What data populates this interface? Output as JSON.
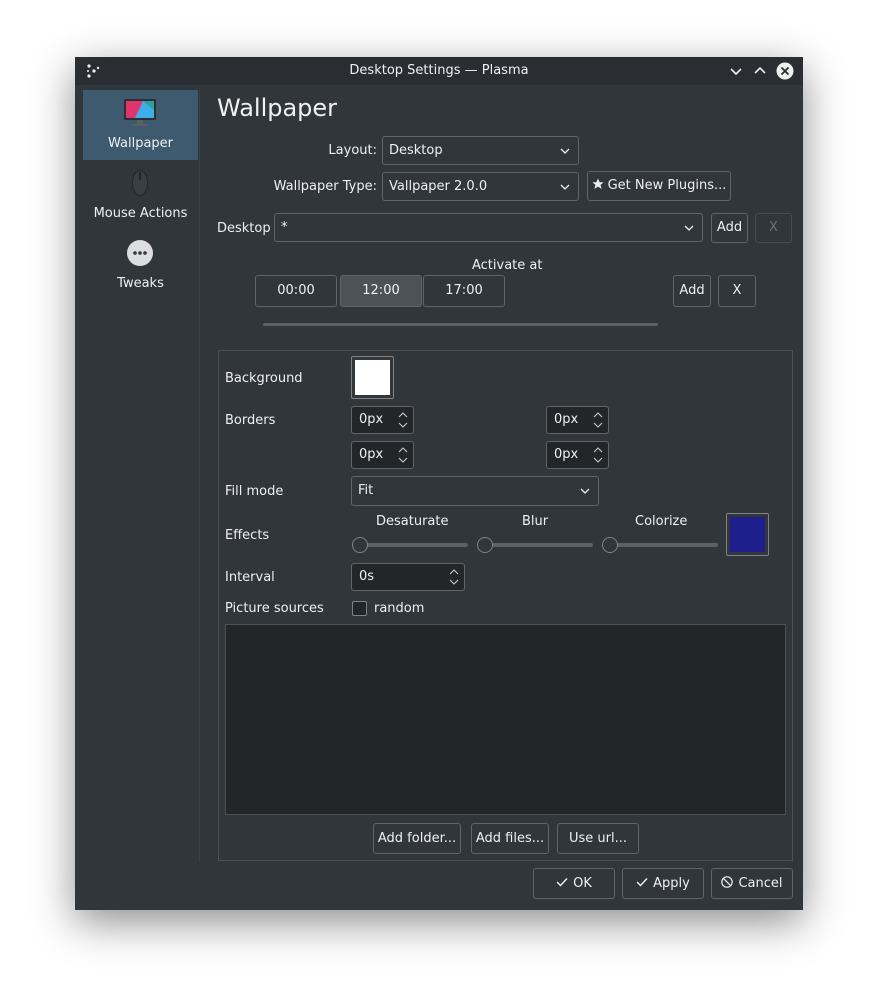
{
  "window": {
    "title": "Desktop Settings — Plasma",
    "controls": {
      "minimize": "chevron-down-icon",
      "maximize": "chevron-up-icon",
      "close": "close-icon"
    }
  },
  "sidebar": {
    "items": [
      {
        "label": "Wallpaper",
        "icon": "monitor-icon",
        "active": true
      },
      {
        "label": "Mouse Actions",
        "icon": "mouse-icon",
        "active": false
      },
      {
        "label": "Tweaks",
        "icon": "more-icon",
        "active": false
      }
    ]
  },
  "main": {
    "heading": "Wallpaper",
    "layout": {
      "label": "Layout:",
      "value": "Desktop"
    },
    "wallpaper_type": {
      "label": "Wallpaper Type:",
      "value": "Vallpaper 2.0.0"
    },
    "get_plugins_label": "Get New Plugins...",
    "desktop": {
      "label": "Desktop",
      "value": "*",
      "add_label": "Add",
      "remove_label": "X"
    },
    "activate": {
      "label": "Activate at",
      "times": [
        "00:00",
        "12:00",
        "17:00"
      ],
      "selected": "12:00",
      "add_label": "Add",
      "remove_label": "X"
    },
    "settings": {
      "background_label": "Background",
      "background_color": "#ffffff",
      "borders_label": "Borders",
      "borders": [
        "0px",
        "0px",
        "0px",
        "0px"
      ],
      "fill_mode_label": "Fill mode",
      "fill_mode_value": "Fit",
      "effects_label": "Effects",
      "effects": [
        {
          "label": "Desaturate",
          "value": 0
        },
        {
          "label": "Blur",
          "value": 0
        },
        {
          "label": "Colorize",
          "value": 0
        }
      ],
      "colorize_color": "#1e1e8c",
      "interval_label": "Interval",
      "interval_value": "0s",
      "picture_sources_label": "Picture sources",
      "random_label": "random",
      "random_checked": false,
      "add_folder_label": "Add folder...",
      "add_files_label": "Add files...",
      "use_url_label": "Use url..."
    }
  },
  "footer": {
    "ok_label": "OK",
    "apply_label": "Apply",
    "cancel_label": "Cancel"
  },
  "colors": {
    "window_bg": "#31363b",
    "accent": "#3daee9",
    "selection": "#3d5a6e"
  }
}
